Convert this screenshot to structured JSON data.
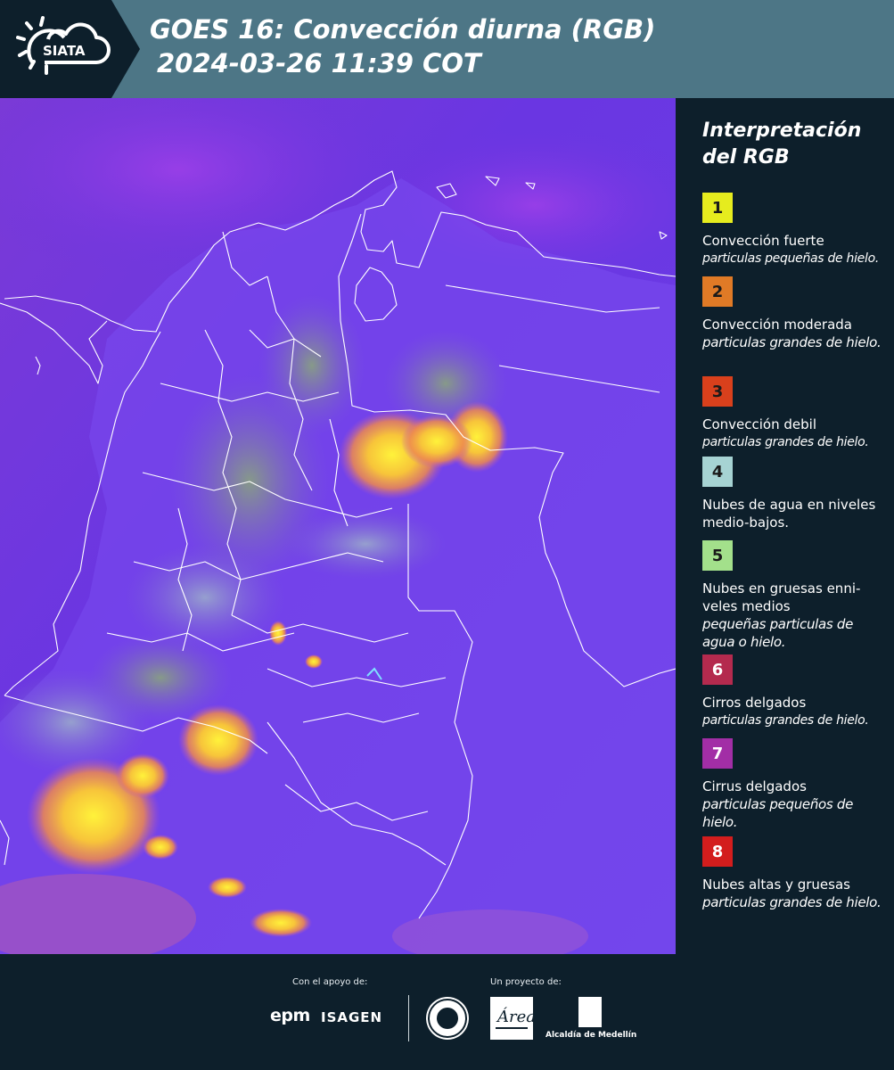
{
  "header": {
    "logo_text": "SIATA",
    "title_line1": "GOES 16: Convección diurna (RGB)",
    "title_line2": "2024-03-26 11:39 COT",
    "band_color": "#4d7686",
    "dark_color": "#0d1f2b"
  },
  "map": {
    "description_colors": {
      "background": "#6a34e0",
      "border_lines": "#ffffff"
    }
  },
  "legend": {
    "title_line1": "Interpretación",
    "title_line2": "del RGB",
    "items": [
      {
        "number": "1",
        "color": "#e6ec1e",
        "label": "Convección fuerte",
        "sub": "particulas pequeñas de hielo."
      },
      {
        "number": "2",
        "color": "#e07a26",
        "label": "Convección moderada",
        "sub": "particulas grandes de hielo."
      },
      {
        "number": "3",
        "color": "#d9401c",
        "label": "Convección debil",
        "sub": "particulas grandes de hielo."
      },
      {
        "number": "4",
        "color": "#a6d3d3",
        "label": "Nubes de agua en niveles medio-bajos.",
        "sub": ""
      },
      {
        "number": "5",
        "color": "#a3e08b",
        "label": "Nubes en gruesas enni-veles medios",
        "sub": "pequeñas particulas de agua o hielo."
      },
      {
        "number": "6",
        "color": "#b42a4e",
        "label": "Cirros delgados",
        "sub": "particulas grandes de hielo."
      },
      {
        "number": "7",
        "color": "#a22ea6",
        "label": "Cirrus delgados",
        "sub": "particulas pequeños de hielo."
      },
      {
        "number": "8",
        "color": "#d31d1d",
        "label": "Nubes altas y gruesas",
        "sub": "particulas grandes de hielo."
      }
    ]
  },
  "footer": {
    "support_caption": "Con el apoyo de:",
    "project_caption": "Un proyecto de:",
    "epm": "epm",
    "isagen": "ISAGEN",
    "alcaldia": "Alcaldía de Medellín"
  }
}
